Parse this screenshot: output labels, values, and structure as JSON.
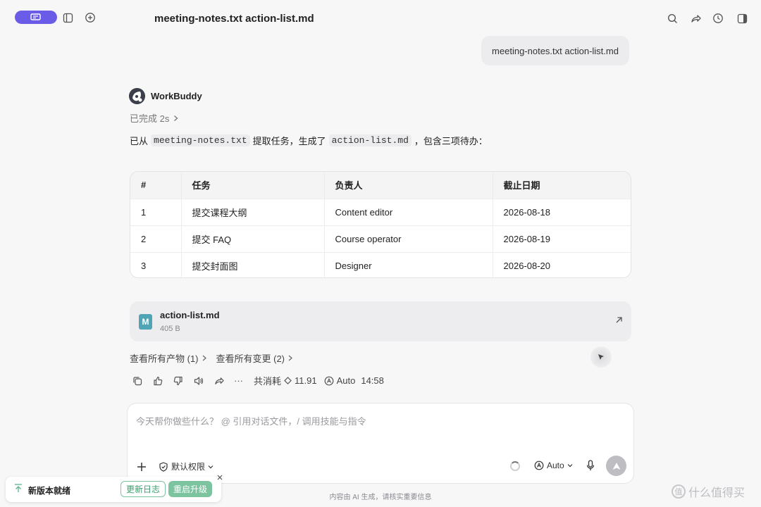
{
  "header": {
    "title": "meeting-notes.txt action-list.md"
  },
  "icons": {
    "pill": "chat-edit-icon",
    "sidebar": "sidebar-toggle-icon",
    "new_chat": "new-chat-icon",
    "search": "search-icon",
    "share": "share-icon",
    "history": "history-icon",
    "panel": "panel-toggle-icon"
  },
  "user_message": "meeting-notes.txt action-list.md",
  "assistant": {
    "name": "WorkBuddy",
    "status": "已完成 2s",
    "msg_prefix": "已从",
    "msg_file1": "meeting-notes.txt",
    "msg_mid": "提取任务，生成了",
    "msg_file2": "action-list.md",
    "msg_suffix": "，包含三项待办："
  },
  "table": {
    "headers": [
      "#",
      "任务",
      "负责人",
      "截止日期"
    ],
    "rows": [
      [
        "1",
        "提交课程大纲",
        "Content editor",
        "2026-08-18"
      ],
      [
        "2",
        "提交 FAQ",
        "Course operator",
        "2026-08-19"
      ],
      [
        "3",
        "提交封面图",
        "Designer",
        "2026-08-20"
      ]
    ]
  },
  "file_card": {
    "icon_letter": "M",
    "name": "action-list.md",
    "size": "405 B"
  },
  "links": {
    "artifacts": "查看所有产物 (1)",
    "changes": "查看所有变更 (2)"
  },
  "actions": {
    "more": "···",
    "usage_label": "共消耗",
    "usage_value": "11.91",
    "model": "Auto",
    "time": "14:58"
  },
  "composer": {
    "placeholder": "今天帮你做些什么？ @ 引用对话文件，/ 调用技能与指令",
    "permission": "默认权限",
    "model": "Auto"
  },
  "disclaimer": "内容由 AI 生成，请核实重要信息",
  "toast": {
    "text": "新版本就绪",
    "changelog": "更新日志",
    "restart": "重启升级"
  },
  "watermark": {
    "badge": "值",
    "text": "什么值得买"
  },
  "colors": {
    "accent": "#6b5ce7",
    "green": "#7cc3a0",
    "file_icon": "#4fa4b5"
  }
}
